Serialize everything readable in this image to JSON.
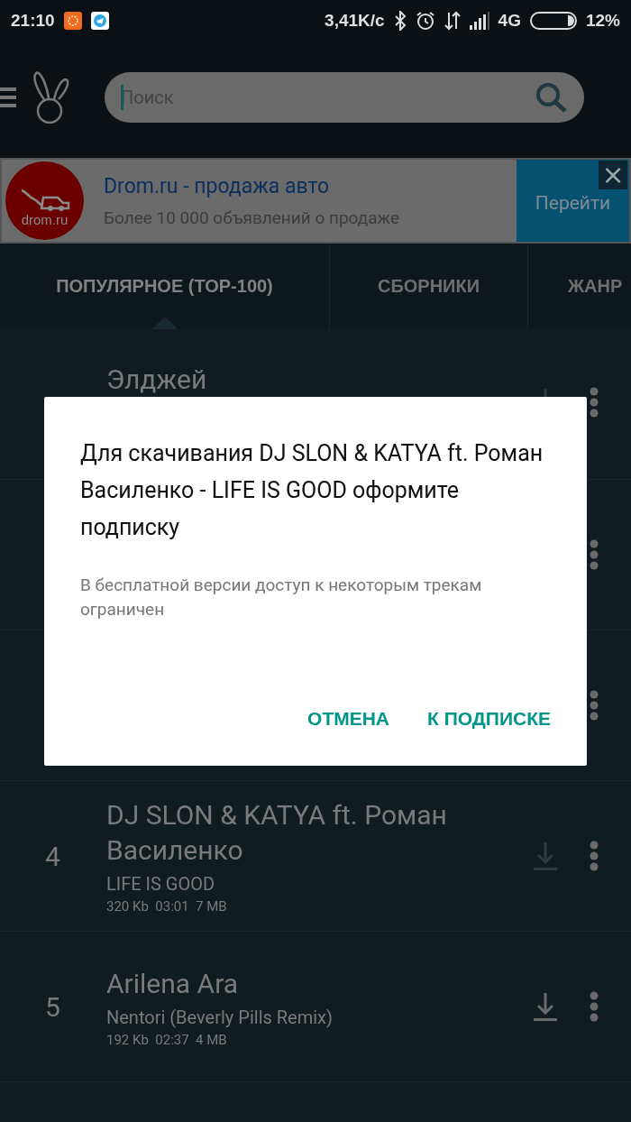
{
  "status_bar": {
    "time": "21:10",
    "speed": "3,41K/с",
    "network": "4G",
    "battery": "12%"
  },
  "toolbar": {
    "search": {
      "placeholder": "Поиск"
    }
  },
  "ad": {
    "logo_text": "drom.ru",
    "title": "Drom.ru - продажа авто",
    "subtitle": "Более 10 000 объявлений о продаже",
    "button": "Перейти",
    "close": "×"
  },
  "tabs": [
    {
      "label": "ПОПУЛЯРНОЕ (ТОР-100)",
      "selected": true
    },
    {
      "label": "СБОРНИКИ",
      "selected": false
    },
    {
      "label": "ЖАНР",
      "selected": false
    }
  ],
  "tracks": [
    {
      "kind": "partial",
      "title": "Элджей",
      "download_disabled": true
    },
    {
      "kind": "covered"
    },
    {
      "kind": "covered"
    },
    {
      "kind": "full",
      "number": "4",
      "title": "DJ SLON & KATYA ft. Роман Василенко",
      "subtitle": "LIFE IS GOOD",
      "meta": "320 Kb  03:01  7 MB",
      "download_disabled": true
    },
    {
      "kind": "full",
      "number": "5",
      "title": "Arilena Ara",
      "subtitle": "Nentori (Beverly Pills Remix)",
      "meta": "192 Kb  02:37  4 MB",
      "download_disabled": false
    }
  ],
  "dialog": {
    "title": "Для скачивания DJ SLON & KATYA ft. Роман Василенко - LIFE IS GOOD оформите подписку",
    "message": "В бесплатной версии доступ к некоторым трекам ограничен",
    "buttons": [
      "ОТМЕНА",
      "К ПОДПИСКЕ"
    ]
  }
}
